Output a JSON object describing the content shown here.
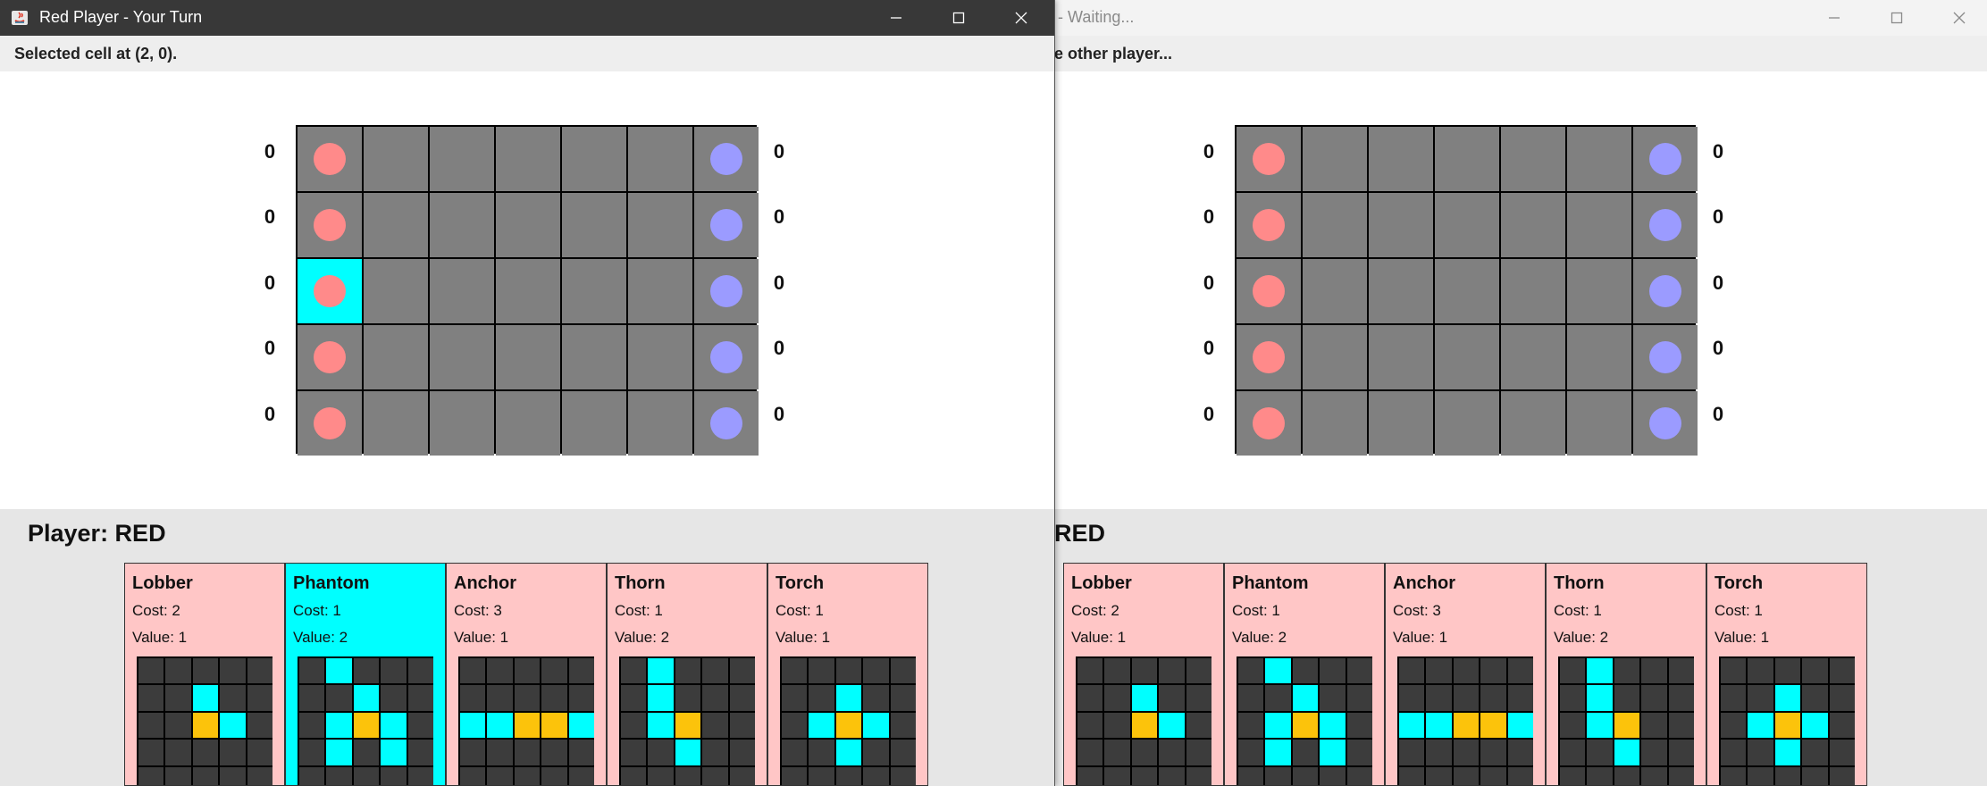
{
  "colors": {
    "red_pawn": "#ff8a8a",
    "blue_pawn": "#9b9bff",
    "board_cell": "#808080",
    "selected_cell": "#00ffff",
    "card_bg": "#ffc6c6",
    "card_selected_bg": "#00ffff",
    "pattern_empty": "#3c3c3c",
    "pattern_influence": "#00ffff",
    "pattern_center": "#fcc30b"
  },
  "red_window": {
    "title": "Red Player - Your Turn",
    "status": "Selected cell at (2, 0).",
    "player_label": "Player: RED",
    "left_scores": [
      "0",
      "0",
      "0",
      "0",
      "0"
    ],
    "right_scores": [
      "0",
      "0",
      "0",
      "0",
      "0"
    ]
  },
  "blue_window": {
    "title": "- Waiting...",
    "status": "e other player...",
    "player_label": "RED",
    "left_scores": [
      "0",
      "0",
      "0",
      "0",
      "0"
    ],
    "right_scores": [
      "0",
      "0",
      "0",
      "0",
      "0"
    ]
  },
  "board": {
    "rows": 5,
    "cols": 7,
    "pawns": [
      {
        "row": 0,
        "col": 0,
        "owner": "red"
      },
      {
        "row": 1,
        "col": 0,
        "owner": "red"
      },
      {
        "row": 2,
        "col": 0,
        "owner": "red"
      },
      {
        "row": 3,
        "col": 0,
        "owner": "red"
      },
      {
        "row": 4,
        "col": 0,
        "owner": "red"
      },
      {
        "row": 0,
        "col": 6,
        "owner": "blue"
      },
      {
        "row": 1,
        "col": 6,
        "owner": "blue"
      },
      {
        "row": 2,
        "col": 6,
        "owner": "blue"
      },
      {
        "row": 3,
        "col": 6,
        "owner": "blue"
      },
      {
        "row": 4,
        "col": 6,
        "owner": "blue"
      }
    ],
    "selected_cell": {
      "row": 2,
      "col": 0
    }
  },
  "cards": [
    {
      "name": "Lobber",
      "cost": "Cost: 2",
      "value": "Value: 1",
      "pattern": [
        ".....",
        "..I..",
        "..CI.",
        ".....",
        "....."
      ]
    },
    {
      "name": "Phantom",
      "cost": "Cost: 1",
      "value": "Value: 2",
      "pattern": [
        ".I...",
        "..I..",
        ".ICI.",
        ".I.I.",
        "....."
      ]
    },
    {
      "name": "Anchor",
      "cost": "Cost: 3",
      "value": "Value: 1",
      "pattern": [
        ".....",
        ".....",
        "IICCI",
        ".....",
        "....."
      ]
    },
    {
      "name": "Thorn",
      "cost": "Cost: 1",
      "value": "Value: 2",
      "pattern": [
        ".I...",
        ".I...",
        ".IC..",
        "..I..",
        "....."
      ]
    },
    {
      "name": "Torch",
      "cost": "Cost: 1",
      "value": "Value: 1",
      "pattern": [
        ".....",
        "..I..",
        ".ICI.",
        "..I..",
        "....."
      ]
    }
  ],
  "selected_card_index_red": 1
}
